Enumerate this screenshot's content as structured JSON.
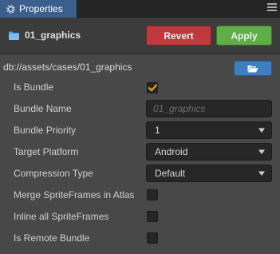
{
  "panel": {
    "tab_label": "Properties"
  },
  "header": {
    "asset_name": "01_graphics",
    "revert_label": "Revert",
    "apply_label": "Apply"
  },
  "path": "db://assets/cases/01_graphics",
  "properties": {
    "is_bundle": {
      "label": "Is Bundle",
      "checked": true
    },
    "bundle_name": {
      "label": "Bundle Name",
      "placeholder": "01_graphics"
    },
    "bundle_priority": {
      "label": "Bundle Priority",
      "value": "1"
    },
    "target_platform": {
      "label": "Target Platform",
      "value": "Android"
    },
    "compression_type": {
      "label": "Compression Type",
      "value": "Default"
    },
    "merge_spriteframes": {
      "label": "Merge SpriteFrames in Atlas",
      "checked": false
    },
    "inline_spriteframes": {
      "label": "Inline all SpriteFrames",
      "checked": false
    },
    "is_remote_bundle": {
      "label": "Is Remote Bundle",
      "checked": false
    }
  },
  "colors": {
    "accent_tab": "#3b5e8c",
    "revert": "#c0393d",
    "apply": "#5fae48",
    "check": "#e8a317",
    "folder_button": "#3d7fc0"
  },
  "icons": {
    "tab": "gear-icon",
    "header": "folder-icon",
    "path_button": "open-folder-icon",
    "menu": "menu-icon"
  }
}
